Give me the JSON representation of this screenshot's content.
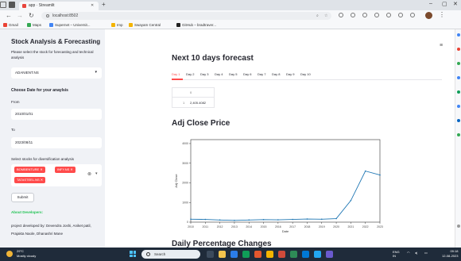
{
  "browser": {
    "tab_title": "app · Streamlit",
    "new_tab_icon": "plus",
    "url": "localhost:8502",
    "bookmarks": [
      "Gmail",
      "Maps",
      "Supernet – Universit...",
      "Imp",
      "Swayam Central",
      "GitHub – bradtraver..."
    ]
  },
  "sidebar": {
    "title": "Stock Analysis & Forecasting",
    "select_prompt": "Please select the stock for forecasting and technical analysis",
    "stock_value": "ADANIENT.NS",
    "date_heading": "Choose Date for your anaylsis",
    "from_label": "From",
    "from_value": "2010/01/01",
    "to_label": "To",
    "to_value": "2023/08/11",
    "diversify_label": "Select stocks for diversification analysis",
    "tags": [
      "BOMBENTURE",
      "INFY.NS",
      "TATASTEEL.NS"
    ],
    "submit_label": "Submit",
    "about_label": "About Developers:",
    "credit_text": "project developed by: Devendra Joshi, Aniket patil, Prajakta Naole, Dhanashri Mane"
  },
  "main": {
    "forecast_heading": "Next 10 days forecast",
    "day_tabs": [
      "Day 1",
      "Day 2",
      "Day 3",
      "Day 4",
      "Day 5",
      "Day 6",
      "Day 7",
      "Day 8",
      "Day 9",
      "Day 10"
    ],
    "table_header": "0",
    "table_index": "1",
    "table_value": "2,405.4082",
    "chart_heading": "Adj Close Price",
    "next_heading": "Daily Percentage Changes"
  },
  "chart_data": {
    "type": "line",
    "title": "",
    "xlabel": "Date",
    "ylabel": "Adj Close",
    "x": [
      "2010",
      "2011",
      "2012",
      "2013",
      "2014",
      "2015",
      "2016",
      "2017",
      "2018",
      "2019",
      "2020",
      "2021",
      "2022",
      "2023"
    ],
    "series": [
      {
        "values": [
          150,
          140,
          110,
          90,
          110,
          130,
          120,
          140,
          160,
          150,
          180,
          1100,
          2600,
          2400
        ]
      }
    ],
    "ylim": [
      0,
      4200
    ],
    "color": "#1f77b4"
  },
  "taskbar": {
    "temp": "29°C",
    "weather": "Mostly cloudy",
    "search": "Search",
    "lang": "ENG",
    "region": "IN",
    "time": "09:18",
    "date": "12-08-2023"
  }
}
